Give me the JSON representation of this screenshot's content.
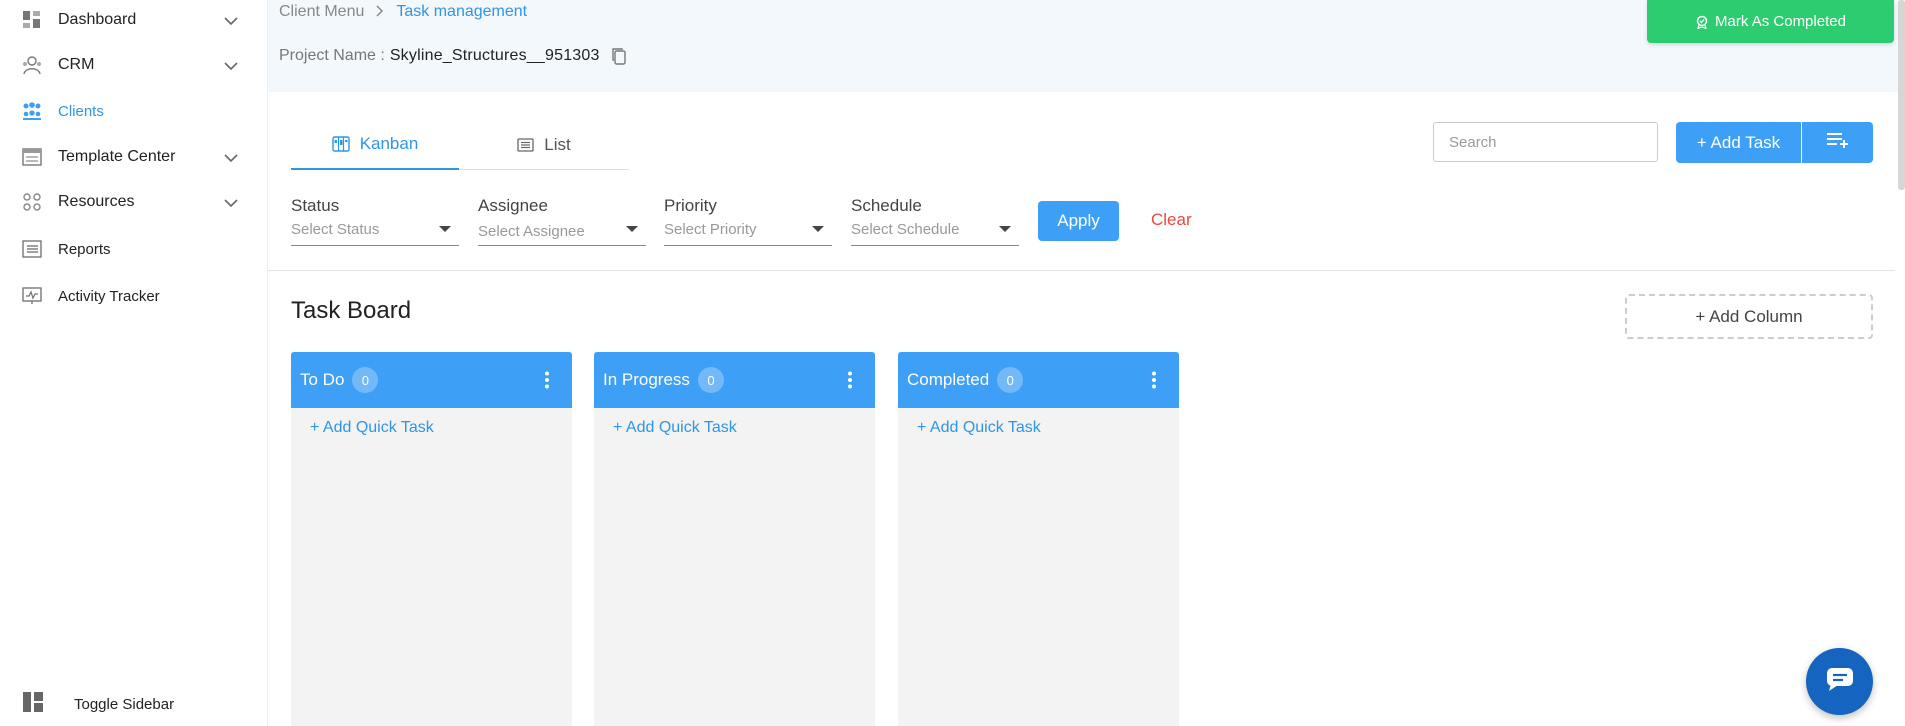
{
  "sidebar": {
    "items": [
      {
        "label": "Dashboard",
        "icon": "dashboard-icon",
        "has_chevron": true
      },
      {
        "label": "CRM",
        "icon": "crm-icon",
        "has_chevron": true
      },
      {
        "label": "Clients",
        "icon": "clients-icon",
        "active": true
      },
      {
        "label": "Template Center",
        "icon": "template-icon",
        "has_chevron": true
      },
      {
        "label": "Resources",
        "icon": "resources-icon",
        "has_chevron": true
      },
      {
        "label": "Reports",
        "icon": "reports-icon"
      },
      {
        "label": "Activity Tracker",
        "icon": "activity-icon"
      }
    ],
    "toggle_label": "Toggle Sidebar"
  },
  "breadcrumb": {
    "parent": "Client Menu",
    "current": "Task management"
  },
  "project": {
    "label": "Project Name :",
    "value": "Skyline_Structures__951303"
  },
  "header": {
    "mark_completed_label": "Mark As Completed"
  },
  "tabs": [
    {
      "label": "Kanban",
      "active": true
    },
    {
      "label": "List",
      "active": false
    }
  ],
  "search": {
    "placeholder": "Search"
  },
  "toolbar": {
    "add_task_label": "+ Add Task"
  },
  "filters": [
    {
      "label": "Status",
      "placeholder": "Select Status"
    },
    {
      "label": "Assignee",
      "placeholder": "Select Assignee"
    },
    {
      "label": "Priority",
      "placeholder": "Select Priority"
    },
    {
      "label": "Schedule",
      "placeholder": "Select Schedule"
    }
  ],
  "filter_actions": {
    "apply_label": "Apply",
    "clear_label": "Clear"
  },
  "board": {
    "title": "Task Board",
    "add_column_label": "+ Add Column",
    "columns": [
      {
        "title": "To Do",
        "count": "0",
        "quick_task_label": "+ Add Quick Task"
      },
      {
        "title": "In Progress",
        "count": "0",
        "quick_task_label": "+ Add Quick Task"
      },
      {
        "title": "Completed",
        "count": "0",
        "quick_task_label": "+ Add Quick Task"
      }
    ]
  },
  "colors": {
    "accent": "#3d9ff5",
    "success": "#2ecc71",
    "danger": "#ea4a3c",
    "header_bg": "#f3f8fd",
    "chat": "#1565c0"
  }
}
